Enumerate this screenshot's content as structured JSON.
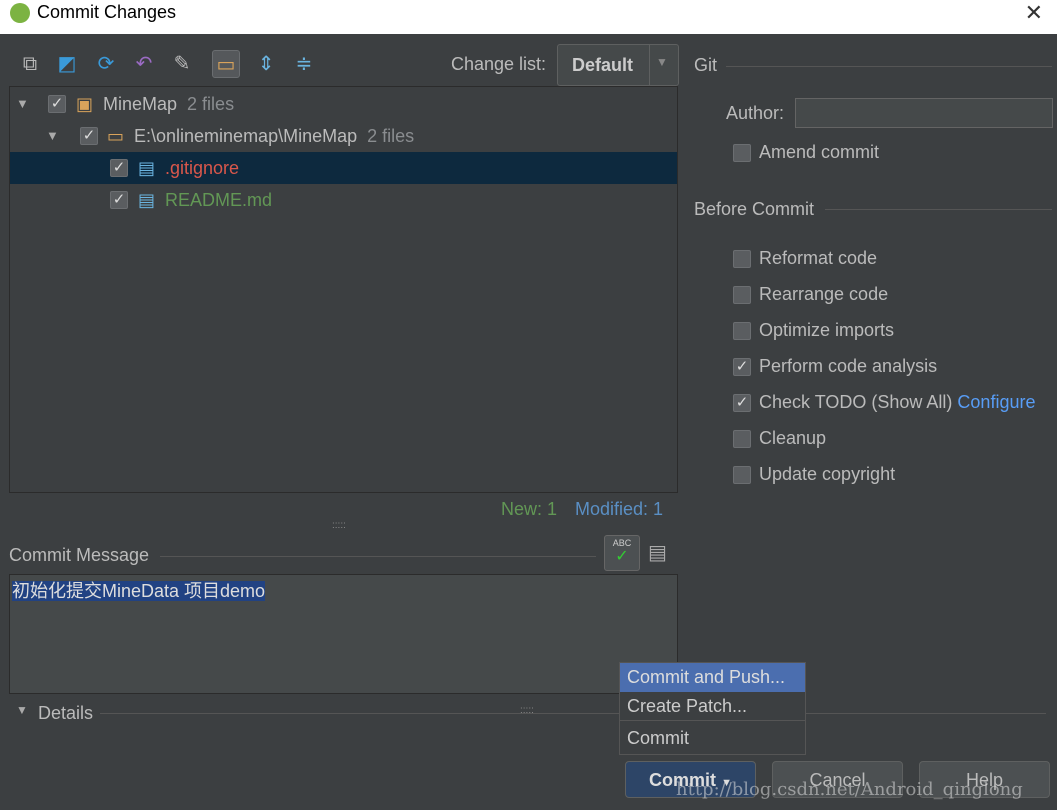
{
  "window": {
    "title": "Commit Changes"
  },
  "toolbar": {
    "changelist_label": "Change list:",
    "changelist_value": "Default"
  },
  "tree": {
    "root": {
      "name": "MineMap",
      "count": "2 files"
    },
    "folder": {
      "name": "E:\\onlineminemap\\MineMap",
      "count": "2 files"
    },
    "files": [
      {
        "name": ".gitignore",
        "color": "#d9574b"
      },
      {
        "name": "README.md",
        "color": "#629755"
      }
    ]
  },
  "status": {
    "new": "New: 1",
    "modified": "Modified: 1"
  },
  "commit_message": {
    "label": "Commit Message",
    "value": "初始化提交MineData 项目demo"
  },
  "details_label": "Details",
  "git": {
    "section": "Git",
    "author_label": "Author:",
    "author_value": "",
    "amend": "Amend commit"
  },
  "before_commit": {
    "section": "Before Commit",
    "options": [
      {
        "label": "Reformat code",
        "checked": false
      },
      {
        "label": "Rearrange code",
        "checked": false
      },
      {
        "label": "Optimize imports",
        "checked": false
      },
      {
        "label": "Perform code analysis",
        "checked": true
      },
      {
        "label": "Check TODO (Show All)",
        "checked": true
      },
      {
        "label": "Cleanup",
        "checked": false
      },
      {
        "label": "Update copyright",
        "checked": false
      }
    ],
    "configure_link": "Configure"
  },
  "menu": {
    "items": [
      "Commit and Push...",
      "Create Patch...",
      "Commit"
    ]
  },
  "buttons": {
    "commit": "Commit",
    "cancel": "Cancel",
    "help": "Help"
  },
  "watermark": "http://blog.csdn.net/Android_qinglong"
}
